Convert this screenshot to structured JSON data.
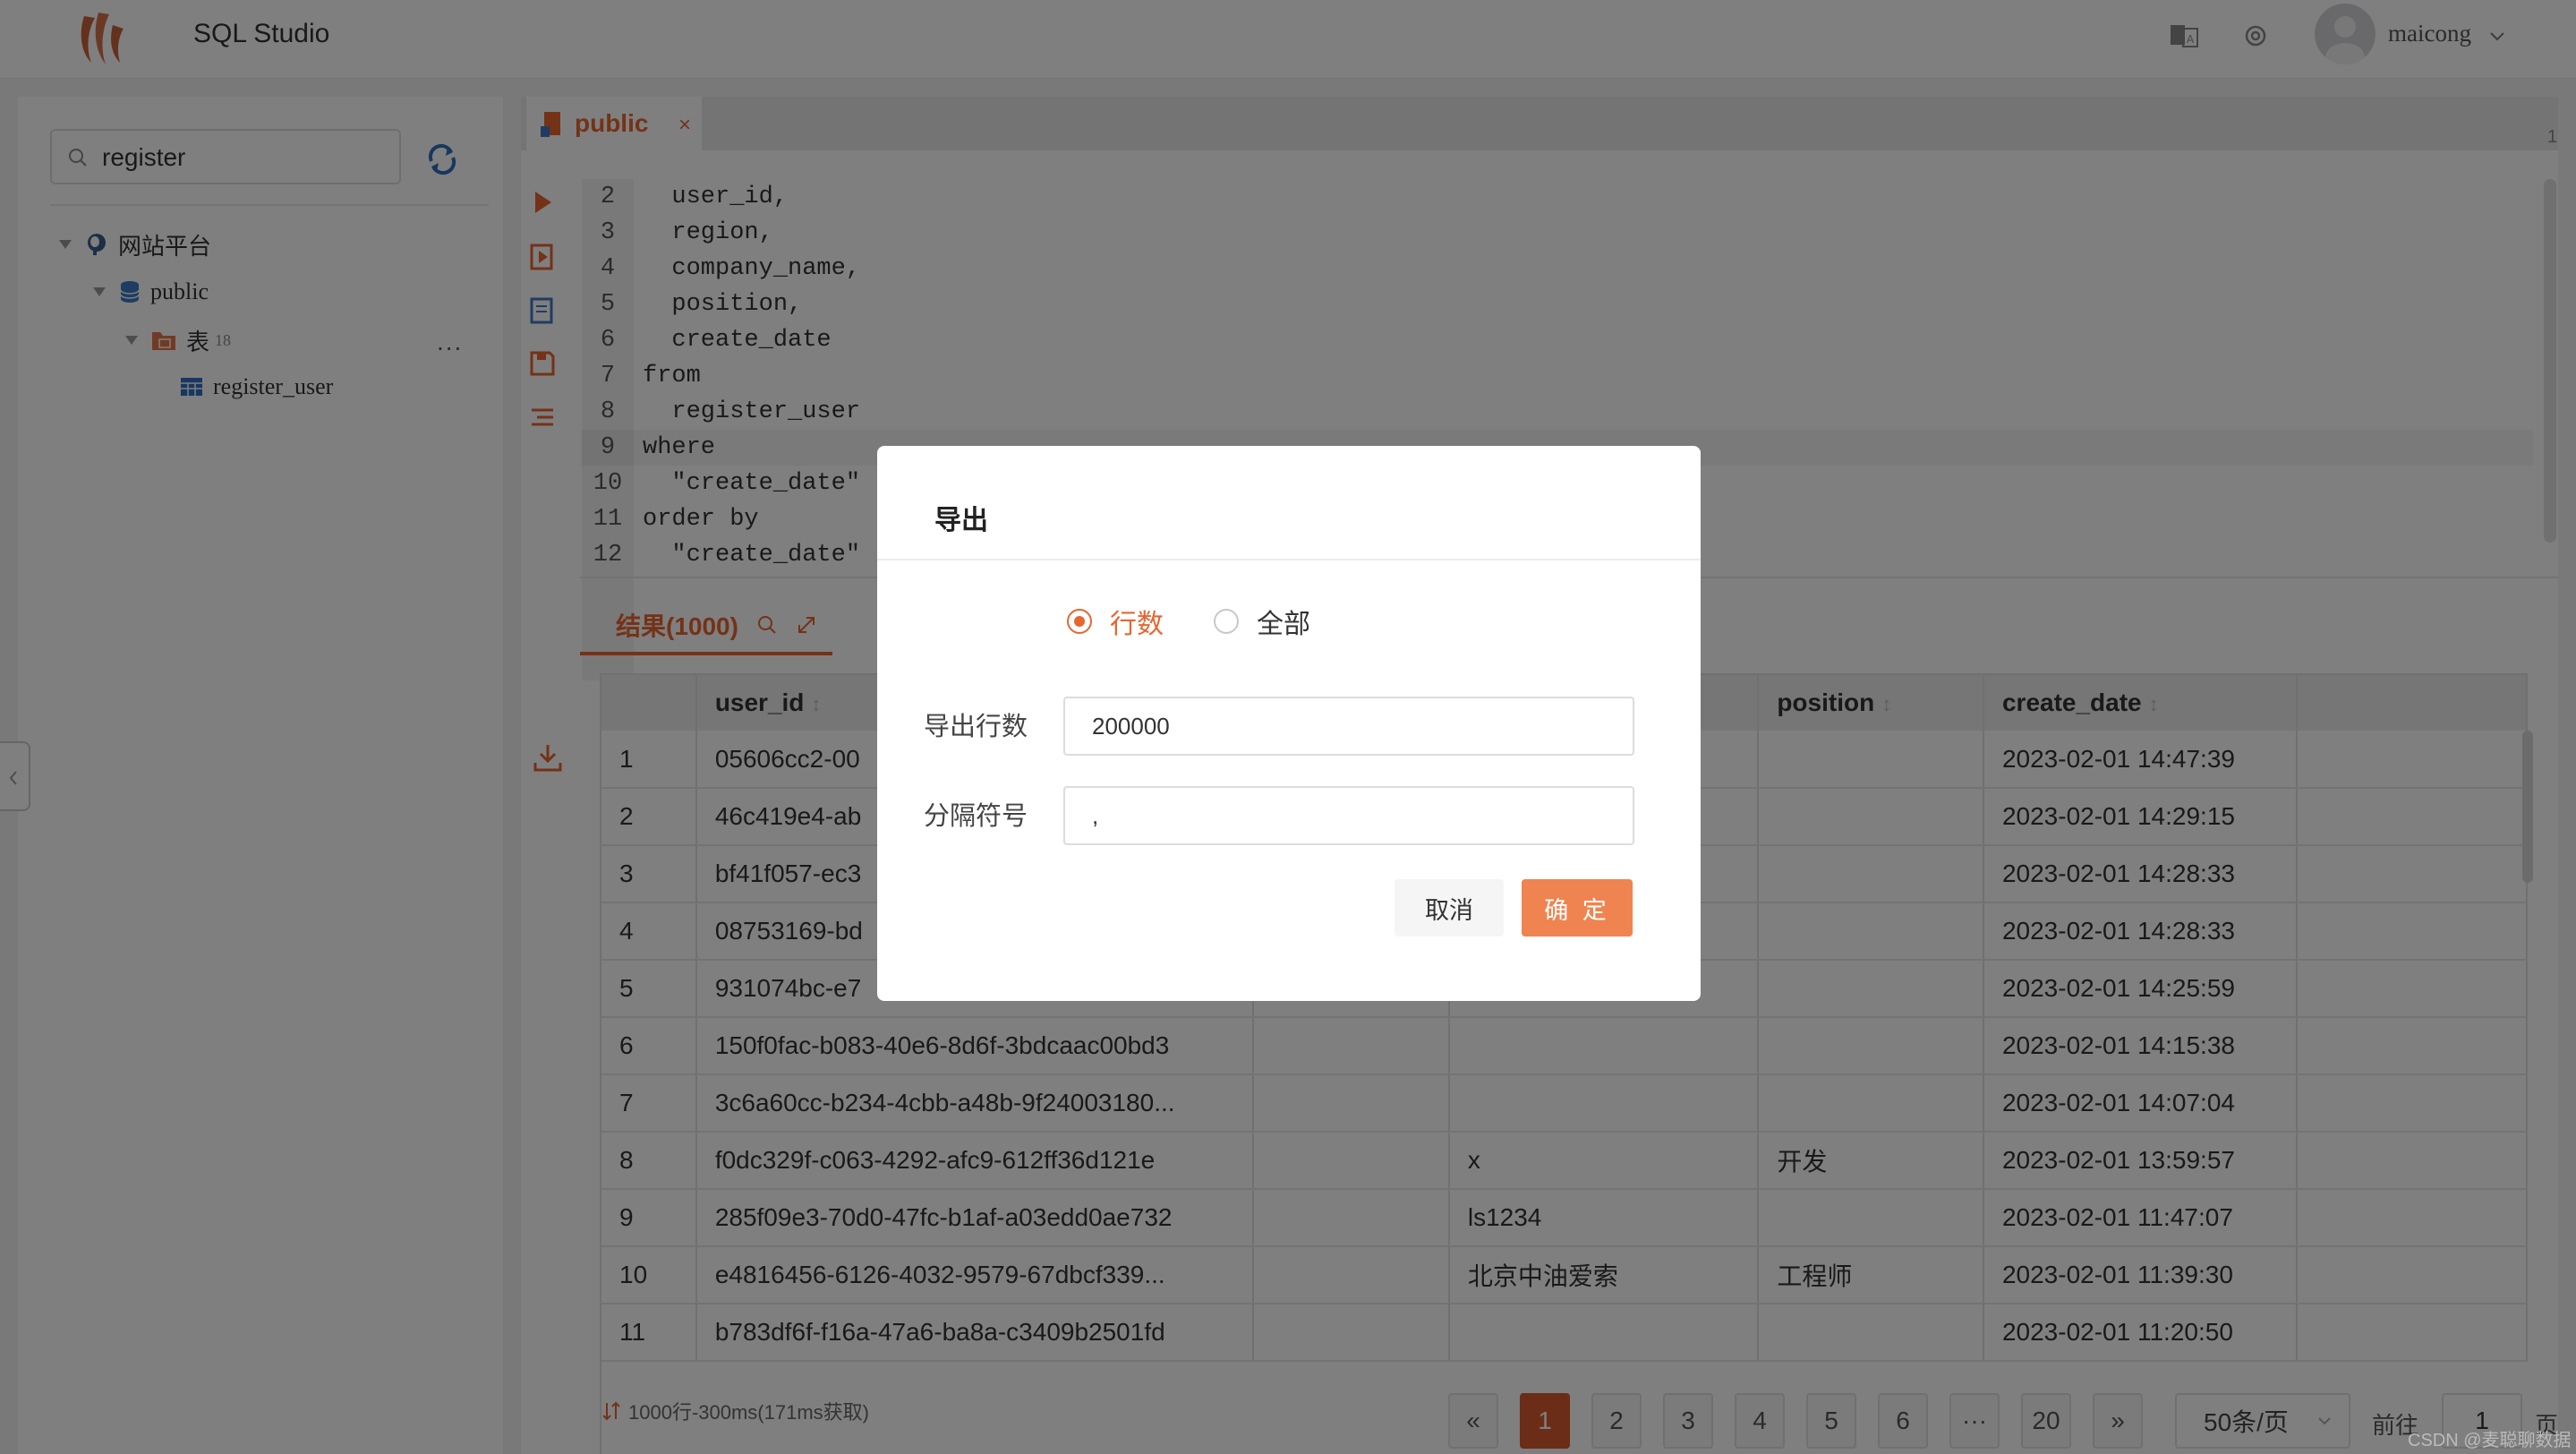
{
  "app": {
    "title": "SQL Studio",
    "user": "maicong"
  },
  "sidebar": {
    "search_value": "register",
    "tree": {
      "root": "网站平台",
      "schema": "public",
      "tables_label": "表",
      "tables_count": "18",
      "table": "register_user",
      "more": "..."
    }
  },
  "editor": {
    "tab": "public",
    "tab_close": "×",
    "line_marker": "1",
    "lines": [
      {
        "n": "2",
        "text": "  user_id,"
      },
      {
        "n": "3",
        "text": "  region,"
      },
      {
        "n": "4",
        "text": "  company_name,"
      },
      {
        "n": "5",
        "text": "  position,"
      },
      {
        "n": "6",
        "text": "  create_date"
      },
      {
        "n": "7",
        "text": "from"
      },
      {
        "n": "8",
        "text": "  register_user"
      },
      {
        "n": "9",
        "text": "where"
      },
      {
        "n": "10",
        "text": "  \"create_date\""
      },
      {
        "n": "11",
        "text": "order by"
      },
      {
        "n": "12",
        "text": "  \"create_date\""
      }
    ]
  },
  "results": {
    "tab_label": "结果(1000)",
    "columns": [
      "",
      "user_id",
      "",
      "",
      "position",
      "create_date"
    ],
    "rows": [
      [
        "1",
        "05606cc2-00",
        "",
        "",
        "",
        "2023-02-01 14:47:39"
      ],
      [
        "2",
        "46c419e4-ab",
        "",
        "",
        "",
        "2023-02-01 14:29:15"
      ],
      [
        "3",
        "bf41f057-ec3",
        "",
        "",
        "",
        "2023-02-01 14:28:33"
      ],
      [
        "4",
        "08753169-bd",
        "",
        "",
        "",
        "2023-02-01 14:28:33"
      ],
      [
        "5",
        "931074bc-e7",
        "",
        "",
        "",
        "2023-02-01 14:25:59"
      ],
      [
        "6",
        "150f0fac-b083-40e6-8d6f-3bdcaac00bd3",
        "",
        "",
        "",
        "2023-02-01 14:15:38"
      ],
      [
        "7",
        "3c6a60cc-b234-4cbb-a48b-9f24003180...",
        "",
        "",
        "",
        "2023-02-01 14:07:04"
      ],
      [
        "8",
        "f0dc329f-c063-4292-afc9-612ff36d121e",
        "",
        "x",
        "开发",
        "2023-02-01 13:59:57"
      ],
      [
        "9",
        "285f09e3-70d0-47fc-b1af-a03edd0ae732",
        "",
        "ls1234",
        "",
        "2023-02-01 11:47:07"
      ],
      [
        "10",
        "e4816456-6126-4032-9579-67dbcf339...",
        "",
        "北京中油爱索",
        "工程师",
        "2023-02-01 11:39:30"
      ],
      [
        "11",
        "b783df6f-f16a-47a6-ba8a-c3409b2501fd",
        "",
        "",
        "",
        "2023-02-01 11:20:50"
      ]
    ],
    "stats": "1000行-300ms(171ms获取)",
    "pages": [
      "1",
      "2",
      "3",
      "4",
      "5",
      "6",
      "···",
      "20"
    ],
    "prev": "«",
    "next": "»",
    "per_page": "50条/页",
    "goto_label": "前往",
    "goto_value": "1",
    "page_suffix": "页"
  },
  "dialog": {
    "title": "导出",
    "radio_rows": "行数",
    "radio_all": "全部",
    "rows_label": "导出行数",
    "rows_value": "200000",
    "sep_label": "分隔符号",
    "sep_value": ",",
    "cancel": "取消",
    "ok": "确 定"
  },
  "watermark": "CSDN @麦聪聊数据",
  "colors": {
    "accent": "#e8652f",
    "primary_button": "#ef8451",
    "active_page": "#d75a2f"
  }
}
